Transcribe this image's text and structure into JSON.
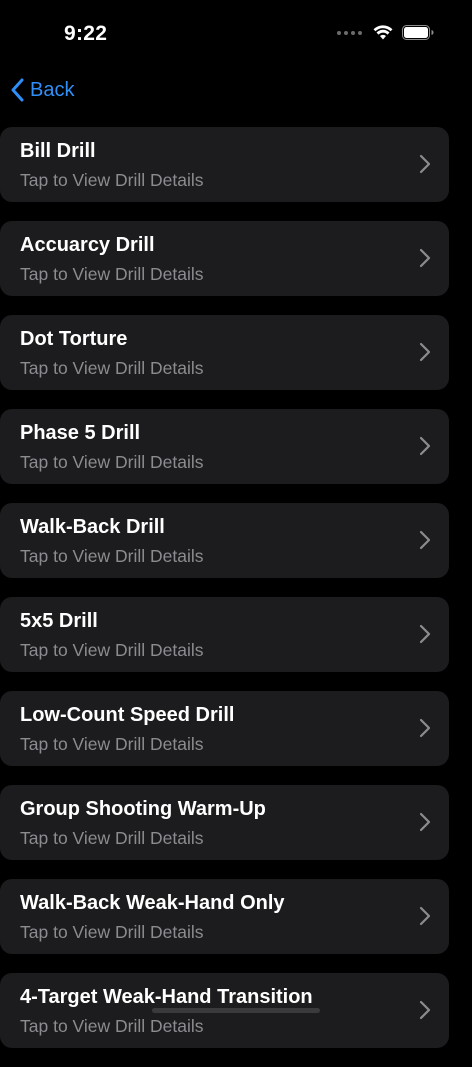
{
  "status_bar": {
    "time": "9:22"
  },
  "nav": {
    "back_label": "Back"
  },
  "colors": {
    "accent": "#2f8ff7",
    "background": "#000000",
    "card": "#1c1c1e",
    "subtitle": "#8c8c90"
  },
  "icons": {
    "back": "chevron-left-icon",
    "row": "chevron-right-icon",
    "wifi": "wifi-icon",
    "battery": "battery-icon",
    "signal": "cellular-signal-icon"
  },
  "drills": [
    {
      "title": "Bill Drill",
      "subtitle": "Tap to View Drill Details"
    },
    {
      "title": "Accuarcy Drill",
      "subtitle": "Tap to View Drill Details"
    },
    {
      "title": "Dot Torture",
      "subtitle": "Tap to View Drill Details"
    },
    {
      "title": "Phase 5 Drill",
      "subtitle": "Tap to View Drill Details"
    },
    {
      "title": "Walk-Back Drill",
      "subtitle": "Tap to View Drill Details"
    },
    {
      "title": "5x5 Drill",
      "subtitle": "Tap to View Drill Details"
    },
    {
      "title": "Low-Count Speed Drill",
      "subtitle": "Tap to View Drill Details"
    },
    {
      "title": "Group Shooting Warm-Up",
      "subtitle": "Tap to View Drill Details"
    },
    {
      "title": "Walk-Back Weak-Hand Only",
      "subtitle": "Tap to View Drill Details"
    },
    {
      "title": "4-Target Weak-Hand Transition",
      "subtitle": "Tap to View Drill Details"
    }
  ]
}
